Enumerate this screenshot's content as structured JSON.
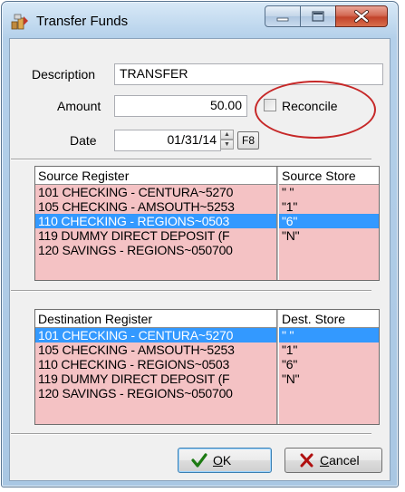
{
  "window": {
    "title": "Transfer Funds"
  },
  "form": {
    "description_label": "Description",
    "description_value": "TRANSFER",
    "amount_label": "Amount",
    "amount_value": "50.00",
    "date_label": "Date",
    "date_value": "01/31/14",
    "f8_label": "F8",
    "reconcile_label": "Reconcile",
    "reconcile_checked": false
  },
  "source": {
    "register_header": "Source Register",
    "store_header": "Source Store",
    "rows": [
      {
        "register": "101  CHECKING - CENTURA~5270",
        "store": "\" \"",
        "selected": false
      },
      {
        "register": "105  CHECKING - AMSOUTH~5253",
        "store": "\"1\"",
        "selected": false
      },
      {
        "register": "110  CHECKING - REGIONS~0503",
        "store": "\"6\"",
        "selected": true
      },
      {
        "register": "119  DUMMY DIRECT DEPOSIT (F",
        "store": "\"N\"",
        "selected": false
      },
      {
        "register": "120  SAVINGS - REGIONS~050700",
        "store": "",
        "selected": false
      }
    ]
  },
  "dest": {
    "register_header": "Destination Register",
    "store_header": "Dest. Store",
    "rows": [
      {
        "register": "101  CHECKING - CENTURA~5270",
        "store": "\" \"",
        "selected": true
      },
      {
        "register": "105  CHECKING - AMSOUTH~5253",
        "store": "\"1\"",
        "selected": false
      },
      {
        "register": "110  CHECKING - REGIONS~0503",
        "store": "\"6\"",
        "selected": false
      },
      {
        "register": "119  DUMMY DIRECT DEPOSIT (F",
        "store": "\"N\"",
        "selected": false
      },
      {
        "register": "120  SAVINGS - REGIONS~050700",
        "store": "",
        "selected": false
      }
    ]
  },
  "buttons": {
    "ok_label": "OK",
    "cancel_label": "Cancel"
  },
  "icons": {
    "app": "transfer-funds-icon",
    "ok": "green-check-icon",
    "cancel": "red-x-icon"
  },
  "colors": {
    "row_bg": "#f4c2c4",
    "selection": "#3399ff",
    "annotation_oval": "#c62828"
  }
}
